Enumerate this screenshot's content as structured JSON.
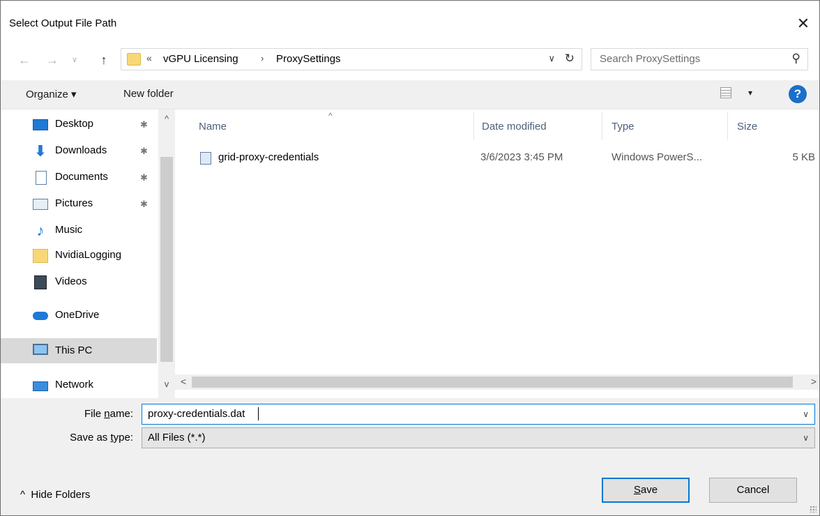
{
  "window": {
    "title": "Select Output File Path",
    "close_glyph": "✕"
  },
  "nav": {
    "back_glyph": "←",
    "forward_glyph": "→",
    "recent_glyph": "∨",
    "up_glyph": "↑"
  },
  "address": {
    "overflow": "«",
    "breadcrumbs": [
      "vGPU Licensing",
      "ProxySettings"
    ],
    "separator": "›",
    "dropdown_glyph": "∨",
    "refresh_glyph": "↻"
  },
  "search": {
    "placeholder": "Search ProxySettings",
    "icon": "search-icon",
    "glyph": "⚲"
  },
  "toolbar": {
    "organize_label": "Organize ▾",
    "new_folder_label": "New folder",
    "view_dropdown_glyph": "▾",
    "help_glyph": "?"
  },
  "sidebar": {
    "items": [
      {
        "label": "Desktop",
        "icon": "desktop-icon",
        "pinned": true
      },
      {
        "label": "Downloads",
        "icon": "downloads-icon",
        "pinned": true
      },
      {
        "label": "Documents",
        "icon": "documents-icon",
        "pinned": true
      },
      {
        "label": "Pictures",
        "icon": "pictures-icon",
        "pinned": true
      },
      {
        "label": "Music",
        "icon": "music-icon",
        "pinned": false
      },
      {
        "label": "NvidiaLogging",
        "icon": "folder-icon",
        "pinned": false
      },
      {
        "label": "Videos",
        "icon": "videos-icon",
        "pinned": false
      },
      {
        "label": "OneDrive",
        "icon": "onedrive-icon",
        "pinned": false
      },
      {
        "label": "This PC",
        "icon": "this-pc-icon",
        "pinned": false,
        "selected": true
      },
      {
        "label": "Network",
        "icon": "network-icon",
        "pinned": false
      }
    ],
    "pin_glyph": "✱",
    "scroll_up_glyph": "^",
    "scroll_down_glyph": "v"
  },
  "file_list": {
    "columns": [
      "Name",
      "Date modified",
      "Type",
      "Size"
    ],
    "sort_glyph": "^",
    "rows": [
      {
        "name": "grid-proxy-credentials",
        "date": "3/6/2023 3:45 PM",
        "type": "Windows PowerS...",
        "size": "5 KB"
      }
    ],
    "scroll_left_glyph": "<",
    "scroll_right_glyph": ">"
  },
  "form": {
    "file_name_label_pre": "File ",
    "file_name_label_u": "n",
    "file_name_label_post": "ame:",
    "file_name_value": "proxy-credentials.dat",
    "save_type_label_pre": "Save as ",
    "save_type_label_u": "t",
    "save_type_label_post": "ype:",
    "save_type_value": "All Files (*.*)",
    "dropdown_glyph": "∨"
  },
  "footer": {
    "hide_folders_glyph": "^",
    "hide_folders_label": "Hide Folders",
    "save_label_u": "S",
    "save_label_rest": "ave",
    "cancel_label": "Cancel"
  },
  "colors": {
    "accent": "#0078d7",
    "selected_bg": "#d9d9d9",
    "footer_bg": "#f0f0f0"
  }
}
